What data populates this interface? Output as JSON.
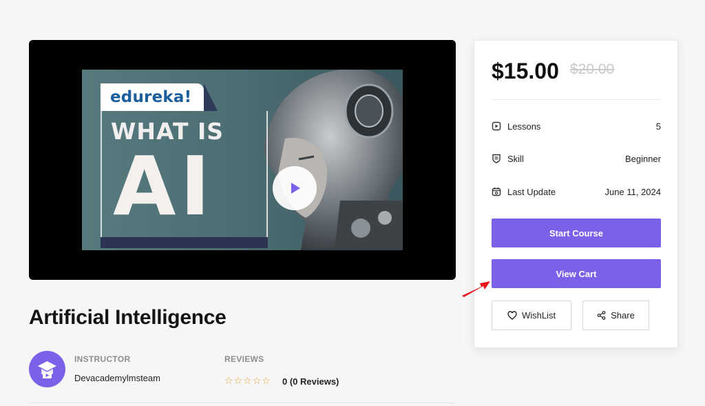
{
  "video": {
    "brand": "edureka!",
    "headline_small": "WHAT IS",
    "headline_big": "AI"
  },
  "course": {
    "title": "Artificial Intelligence",
    "instructor_label": "INSTRUCTOR",
    "instructor_name": "Devacademylmsteam",
    "reviews_label": "REVIEWS",
    "stars_filled": 0,
    "stars_total": 5,
    "rating_text": "0 (0 Reviews)"
  },
  "sidebar": {
    "price": "$15.00",
    "old_price": "$20.00",
    "rows": [
      {
        "label": "Lessons",
        "value": "5",
        "icon": "lessons-icon"
      },
      {
        "label": "Skill",
        "value": "Beginner",
        "icon": "skill-icon"
      },
      {
        "label": "Last Update",
        "value": "June 11, 2024",
        "icon": "calendar-icon"
      }
    ],
    "start_label": "Start Course",
    "cart_label": "View Cart",
    "wishlist_label": "WishList",
    "share_label": "Share"
  },
  "colors": {
    "accent": "#7b61e8",
    "annotation_arrow": "#e8121b"
  }
}
